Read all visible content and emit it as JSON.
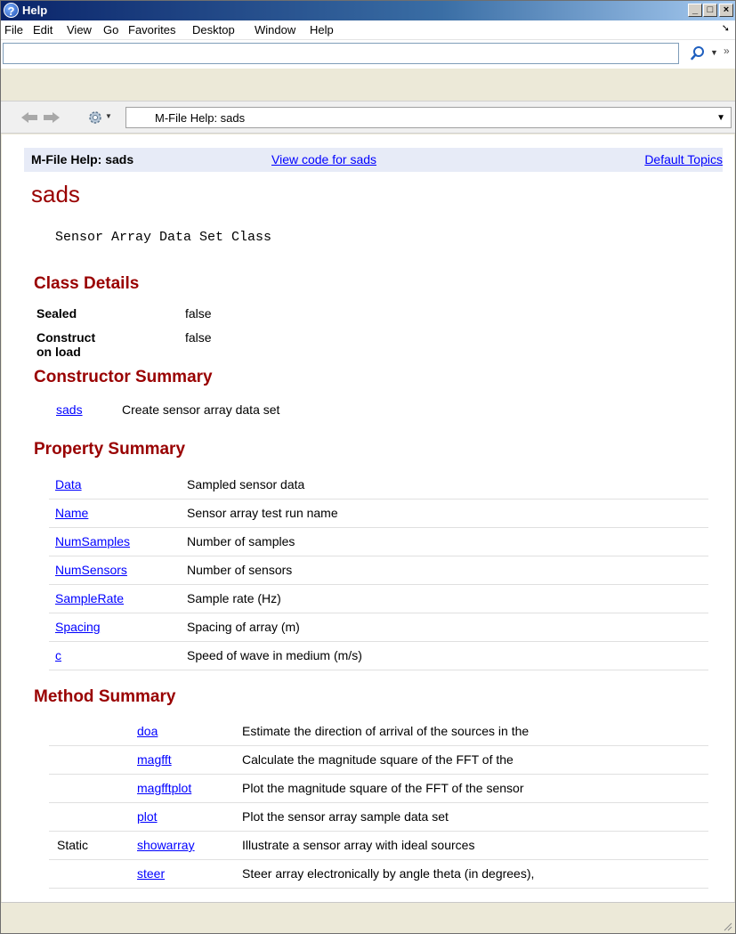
{
  "window": {
    "title": "Help"
  },
  "menu": {
    "items": [
      "File",
      "Edit",
      "View",
      "Go",
      "Favorites",
      "Desktop",
      "Window",
      "Help"
    ]
  },
  "search": {
    "value": "",
    "placeholder": ""
  },
  "nav": {
    "address": "M-File Help: sads"
  },
  "header": {
    "title": "M-File Help: sads",
    "view_code": "View code for sads",
    "default_topics": "Default Topics"
  },
  "page": {
    "title": "sads",
    "description": "Sensor Array Data Set Class"
  },
  "class_details": {
    "heading": "Class Details",
    "rows": [
      {
        "key": "Sealed",
        "value": "false"
      },
      {
        "key": "Construct on load",
        "value": "false"
      }
    ]
  },
  "constructor_summary": {
    "heading": "Constructor Summary",
    "name": "sads",
    "description": "Create sensor array data set"
  },
  "property_summary": {
    "heading": "Property Summary",
    "rows": [
      {
        "name": "Data",
        "description": "Sampled sensor data"
      },
      {
        "name": "Name",
        "description": "Sensor array test run name"
      },
      {
        "name": "NumSamples",
        "description": "Number of samples"
      },
      {
        "name": "NumSensors",
        "description": "Number of sensors"
      },
      {
        "name": "SampleRate",
        "description": "Sample rate (Hz)"
      },
      {
        "name": "Spacing",
        "description": "Spacing of array (m)"
      },
      {
        "name": "c",
        "description": "Speed of wave in medium (m/s)"
      }
    ]
  },
  "method_summary": {
    "heading": "Method Summary",
    "rows": [
      {
        "attr": "",
        "name": "doa",
        "description": "Estimate the direction of arrival of the sources in the"
      },
      {
        "attr": "",
        "name": "magfft",
        "description": "Calculate the magnitude square of the FFT of the"
      },
      {
        "attr": "",
        "name": "magfftplot",
        "description": "Plot the magnitude square of the FFT of the sensor"
      },
      {
        "attr": "",
        "name": "plot",
        "description": "Plot the sensor array sample data set"
      },
      {
        "attr": "Static",
        "name": "showarray",
        "description": "Illustrate a sensor array with ideal sources"
      },
      {
        "attr": "",
        "name": "steer",
        "description": "Steer array electronically by angle theta (in degrees),"
      }
    ]
  },
  "colors": {
    "heading": "#990000",
    "link": "#0000ff",
    "header_bar": "#e7ebf7"
  }
}
